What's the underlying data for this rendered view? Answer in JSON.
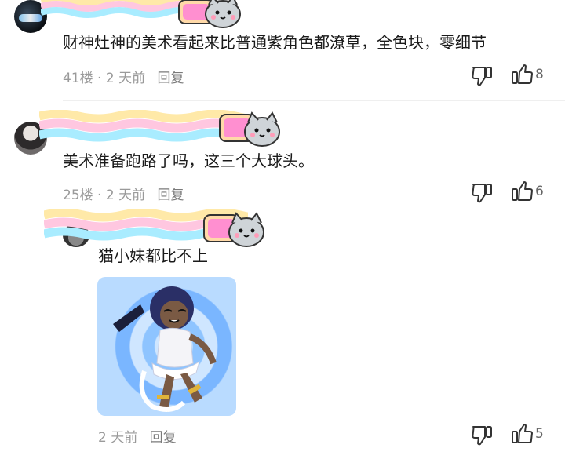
{
  "comments": [
    {
      "text": "财神灶神的美术看起来比普通紫角色都潦草，全色块，零细节",
      "meta": "41楼 · 2 天前",
      "reply": "回复",
      "likes": "8"
    },
    {
      "text": "美术准备跑路了吗，这三个大球头。",
      "meta": "25楼 · 2 天前",
      "reply": "回复",
      "likes": "6"
    }
  ],
  "reply_comment": {
    "text": "猫小妹都比不上",
    "meta": "2 天前",
    "reply": "回复",
    "likes": "5"
  },
  "colors": {
    "rainbow": [
      "#ffe9a8",
      "#ffc7e0",
      "#a9ecff"
    ],
    "meta_text": "#9a9a9a"
  },
  "icons": [
    "dislike-icon",
    "like-icon",
    "nyan-cat-icon",
    "rainbow-trail"
  ]
}
